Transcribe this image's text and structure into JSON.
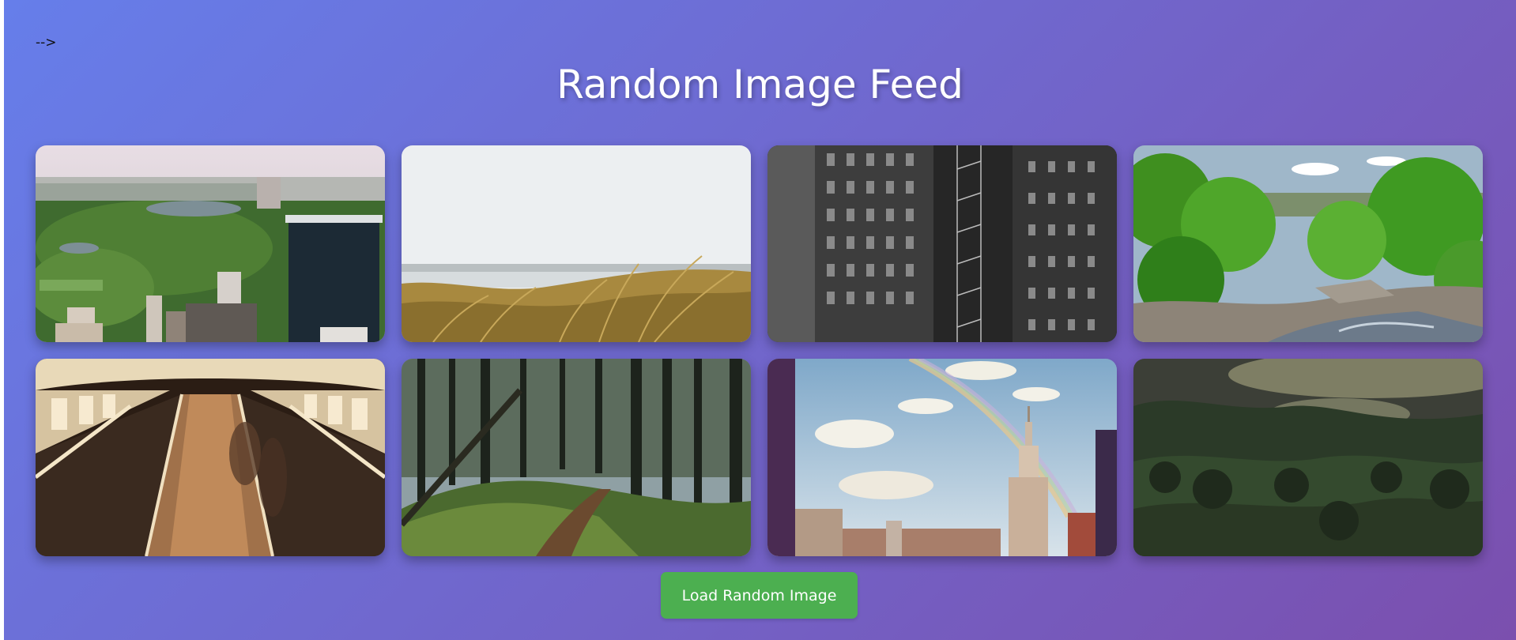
{
  "page": {
    "stray_text": "-->",
    "title": "Random Image Feed"
  },
  "images": [
    {
      "subject": "city park aerial view"
    },
    {
      "subject": "beach dune grass"
    },
    {
      "subject": "black and white building facade"
    },
    {
      "subject": "green forest with rocky stream"
    },
    {
      "subject": "subway escalator tunnel"
    },
    {
      "subject": "forest trail with pine trees"
    },
    {
      "subject": "city skyline with rainbow"
    },
    {
      "subject": "misty forest hills"
    }
  ],
  "actions": {
    "load_button_label": "Load Random Image"
  },
  "colors": {
    "gradient_start": "#667eea",
    "gradient_end": "#7b4fae",
    "button_bg": "#4caf50"
  }
}
